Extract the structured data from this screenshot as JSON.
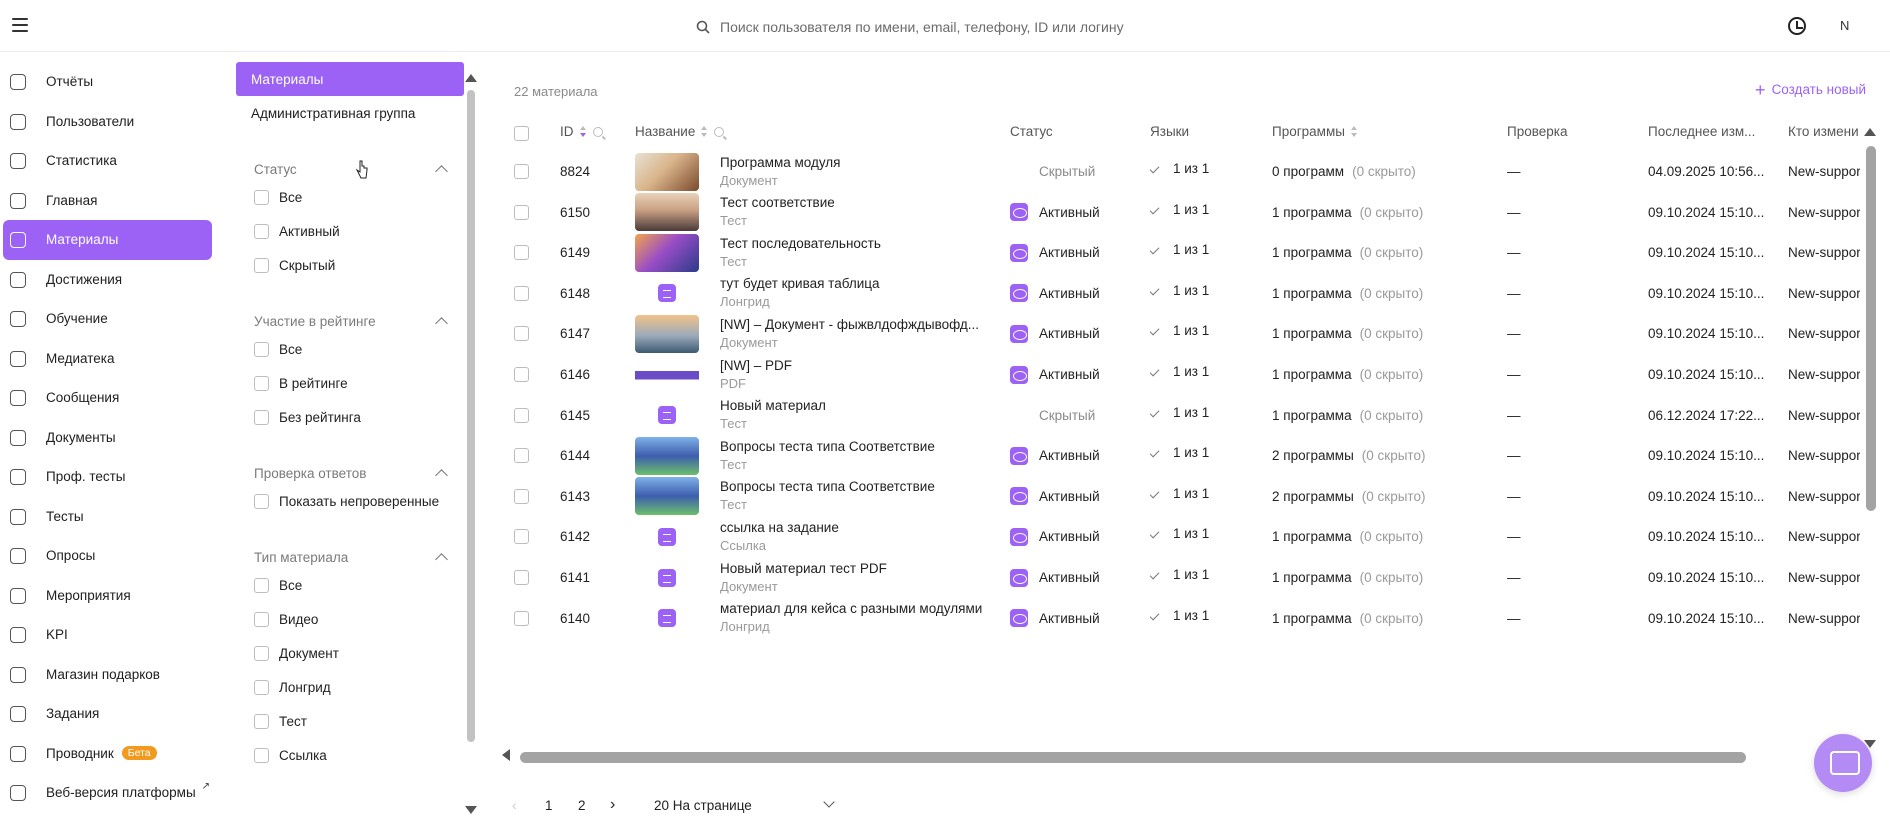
{
  "header": {
    "search_placeholder": "Поиск пользователя по имени, email, телефону, ID или логину",
    "user_initial": "N"
  },
  "nav": {
    "items": [
      {
        "label": "Отчёты",
        "icon": "report-icon"
      },
      {
        "label": "Пользователи",
        "icon": "users-icon"
      },
      {
        "label": "Статистика",
        "icon": "chart-icon"
      },
      {
        "label": "Главная",
        "icon": "home-icon"
      },
      {
        "label": "Материалы",
        "icon": "document-icon",
        "active": true
      },
      {
        "label": "Достижения",
        "icon": "trophy-icon"
      },
      {
        "label": "Обучение",
        "icon": "education-icon"
      },
      {
        "label": "Медиатека",
        "icon": "media-icon"
      },
      {
        "label": "Сообщения",
        "icon": "message-icon"
      },
      {
        "label": "Документы",
        "icon": "info-icon"
      },
      {
        "label": "Проф. тесты",
        "icon": "prof-test-icon"
      },
      {
        "label": "Тесты",
        "icon": "test-icon"
      },
      {
        "label": "Опросы",
        "icon": "survey-icon"
      },
      {
        "label": "Мероприятия",
        "icon": "calendar-icon"
      },
      {
        "label": "KPI",
        "icon": "kpi-icon"
      },
      {
        "label": "Магазин подарков",
        "icon": "gift-icon"
      },
      {
        "label": "Задания",
        "icon": "task-icon"
      },
      {
        "label": "Проводник",
        "icon": "folder-icon",
        "badge": "Бета"
      },
      {
        "label": "Веб-версия платформы",
        "icon": "monitor-icon",
        "external": "↗"
      }
    ]
  },
  "filters": {
    "tabs": [
      "Материалы",
      "Административная группа"
    ],
    "groups": [
      {
        "title": "Статус",
        "options": [
          "Все",
          "Активный",
          "Скрытый"
        ]
      },
      {
        "title": "Участие в рейтинге",
        "options": [
          "Все",
          "В рейтинге",
          "Без рейтинга"
        ]
      },
      {
        "title": "Проверка ответов",
        "options": [
          "Показать непроверенные"
        ]
      },
      {
        "title": "Тип материала",
        "options": [
          "Все",
          "Видео",
          "Документ",
          "Лонгрид",
          "Тест",
          "Ссылка"
        ]
      }
    ]
  },
  "main": {
    "count": "22 материала",
    "create_label": "Создать новый",
    "columns": [
      "ID",
      "Название",
      "Статус",
      "Языки",
      "Программы",
      "Проверка",
      "Последнее изм...",
      "Кто измени"
    ],
    "rows": [
      {
        "id": "8824",
        "title": "Программа модуля",
        "type": "Документ",
        "status": "Скрытый",
        "lang": "1 из 1",
        "programs": "0 программ",
        "hidden": "(0 скрыто)",
        "check": "—",
        "date": "04.09.2025 10:56...",
        "author": "New-suppor",
        "thumb": "photo-cat"
      },
      {
        "id": "6150",
        "title": "Тест соответствие",
        "type": "Тест",
        "status": "Активный",
        "lang": "1 из 1",
        "programs": "1 программа",
        "hidden": "(0 скрыто)",
        "check": "—",
        "date": "09.10.2024 15:10...",
        "author": "New-suppor",
        "thumb": "photo-mountain"
      },
      {
        "id": "6149",
        "title": "Тест последовательность",
        "type": "Тест",
        "status": "Активный",
        "lang": "1 из 1",
        "programs": "1 программа",
        "hidden": "(0 скрыто)",
        "check": "—",
        "date": "09.10.2024 15:10...",
        "author": "New-suppor",
        "thumb": "photo-galaxy"
      },
      {
        "id": "6148",
        "title": "тут будет кривая таблица",
        "type": "Лонгрид",
        "status": "Активный",
        "lang": "1 из 1",
        "programs": "1 программа",
        "hidden": "(0 скрыто)",
        "check": "—",
        "date": "09.10.2024 15:10...",
        "author": "New-suppor",
        "thumb": "icon-longread"
      },
      {
        "id": "6147",
        "title": "[NW] – Документ - фыжвлдофждывофд...",
        "type": "Документ",
        "status": "Активный",
        "lang": "1 из 1",
        "programs": "1 программа",
        "hidden": "(0 скрыто)",
        "check": "—",
        "date": "09.10.2024 15:10...",
        "author": "New-suppor",
        "thumb": "photo-sunset"
      },
      {
        "id": "6146",
        "title": "[NW] – PDF",
        "type": "PDF",
        "status": "Активный",
        "lang": "1 из 1",
        "programs": "1 программа",
        "hidden": "(0 скрыто)",
        "check": "—",
        "date": "09.10.2024 15:10...",
        "author": "New-suppor",
        "thumb": "screenshot"
      },
      {
        "id": "6145",
        "title": "Новый материал",
        "type": "Тест",
        "status": "Скрытый",
        "lang": "1 из 1",
        "programs": "1 программа",
        "hidden": "(0 скрыто)",
        "check": "—",
        "date": "06.12.2024 17:22...",
        "author": "New-suppor",
        "thumb": "icon-test"
      },
      {
        "id": "6144",
        "title": "Вопросы теста типа Соответствие",
        "type": "Тест",
        "status": "Активный",
        "lang": "1 из 1",
        "programs": "2 программы",
        "hidden": "(0 скрыто)",
        "check": "—",
        "date": "09.10.2024 15:10...",
        "author": "New-suppor",
        "thumb": "photo-anime"
      },
      {
        "id": "6143",
        "title": "Вопросы теста типа Соответствие",
        "type": "Тест",
        "status": "Активный",
        "lang": "1 из 1",
        "programs": "2 программы",
        "hidden": "(0 скрыто)",
        "check": "—",
        "date": "09.10.2024 15:10...",
        "author": "New-suppor",
        "thumb": "photo-anime"
      },
      {
        "id": "6142",
        "title": "ссылка на задание",
        "type": "Ссылка",
        "status": "Активный",
        "lang": "1 из 1",
        "programs": "1 программа",
        "hidden": "(0 скрыто)",
        "check": "—",
        "date": "09.10.2024 15:10...",
        "author": "New-suppor",
        "thumb": "icon-link"
      },
      {
        "id": "6141",
        "title": "Новый материал тест PDF",
        "type": "Документ",
        "status": "Активный",
        "lang": "1 из 1",
        "programs": "1 программа",
        "hidden": "(0 скрыто)",
        "check": "—",
        "date": "09.10.2024 15:10...",
        "author": "New-suppor",
        "thumb": "icon-document"
      },
      {
        "id": "6140",
        "title": "материал для кейса с разными модулями",
        "type": "Лонгрид",
        "status": "Активный",
        "lang": "1 из 1",
        "programs": "1 программа",
        "hidden": "(0 скрыто)",
        "check": "—",
        "date": "09.10.2024 15:10...",
        "author": "New-suppor",
        "thumb": "icon-longread"
      }
    ]
  },
  "pagination": {
    "pages": [
      "1",
      "2"
    ],
    "page_size": "20 На странице"
  },
  "colors": {
    "accent": "#9b62f5",
    "badge": "#f29a1e"
  }
}
